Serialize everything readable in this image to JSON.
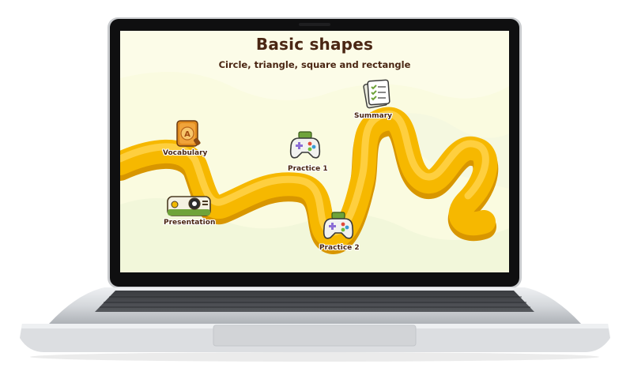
{
  "lesson": {
    "title": "Basic shapes",
    "subtitle": "Circle, triangle, square and rectangle"
  },
  "path_nodes": [
    {
      "label": "Vocabulary",
      "icon": "book-icon"
    },
    {
      "label": "Presentation",
      "icon": "projector-icon"
    },
    {
      "label": "Practice 1",
      "icon": "gamepad-icon"
    },
    {
      "label": "Practice 2",
      "icon": "gamepad-icon"
    },
    {
      "label": "Summary",
      "icon": "checklist-icon"
    }
  ],
  "colors": {
    "screen_background": "#fafbe0",
    "path_yellow": "#f6b800",
    "path_shadow": "#d99a00",
    "text_brown": "#4a2613",
    "laptop_silver": "#d8dadd",
    "bezel": "#111111"
  }
}
